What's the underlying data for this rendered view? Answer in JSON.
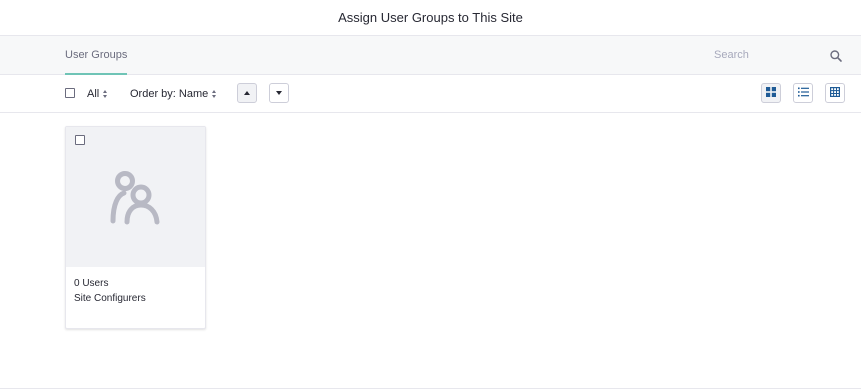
{
  "modal": {
    "title": "Assign User Groups to This Site"
  },
  "navbar": {
    "tab_label": "User Groups",
    "search_placeholder": "Search",
    "search_icon": "search-icon"
  },
  "toolbar": {
    "filter_label": "All",
    "order_label": "Order by: Name",
    "sort_ascending_icon": "caret-up-icon",
    "sort_descending_icon": "caret-down-icon",
    "view_modes": [
      "cards-view-icon",
      "list-view-icon",
      "table-view-icon"
    ],
    "active_view": "cards"
  },
  "cards": [
    {
      "count": "0 Users",
      "name": "Site Configurers",
      "icon": "user-group-icon",
      "checked": false
    }
  ],
  "colors": {
    "accent": "#6fc4b6",
    "text": "#272833",
    "muted": "#6b6c7e",
    "placeholder": "#a7a9bc",
    "card_bg": "#f1f2f5",
    "icon_gray": "#b8b9c4",
    "view_icon_blue": "#1f5b96"
  }
}
